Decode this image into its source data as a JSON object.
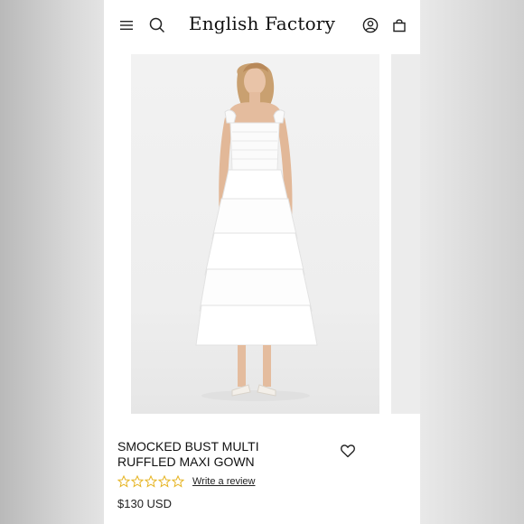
{
  "header": {
    "brand": "English Factory",
    "icons": [
      "menu-icon",
      "search-icon",
      "account-icon",
      "bag-icon"
    ]
  },
  "product": {
    "title": "SMOCKED BUST MULTI RUFFLED MAXI GOWN",
    "rating_stars": 0,
    "rating_max": 5,
    "review_link": "Write a review",
    "price": "$130 USD",
    "star_color": "#e6b422"
  }
}
